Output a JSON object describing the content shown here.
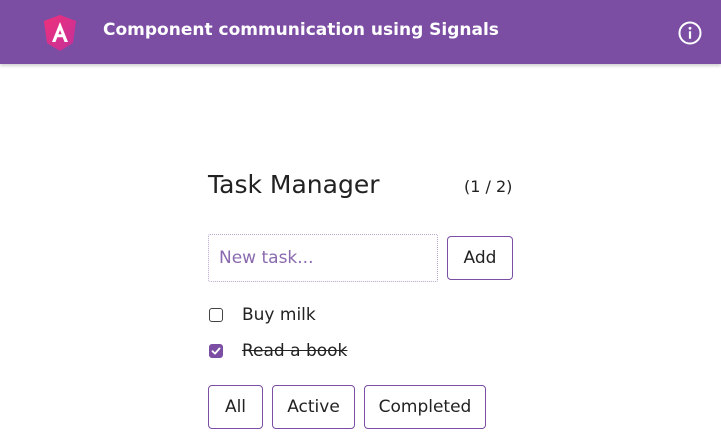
{
  "header": {
    "title": "Component communication using Signals",
    "logo_icon": "angular-logo-icon",
    "info_icon": "info-icon",
    "background": "#7b4ea3"
  },
  "task_manager": {
    "heading": "Task Manager",
    "count": "(1 / 2)",
    "input": {
      "placeholder": "New task...",
      "value": ""
    },
    "add_label": "Add",
    "tasks": [
      {
        "label": "Buy milk",
        "completed": false
      },
      {
        "label": "Read a book",
        "completed": true
      }
    ],
    "filters": [
      {
        "label": "All"
      },
      {
        "label": "Active"
      },
      {
        "label": "Completed"
      }
    ]
  },
  "colors": {
    "accent": "#7b4ea3",
    "logo_pink": "#e8337a"
  }
}
